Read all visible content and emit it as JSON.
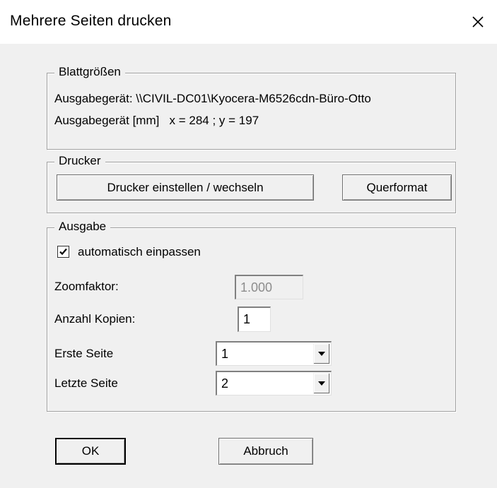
{
  "window": {
    "title": "Mehrere Seiten drucken",
    "close_icon": "close-icon"
  },
  "blattgroessen": {
    "legend": "Blattgrößen",
    "device_line": "Ausgabegerät: \\\\CIVIL-DC01\\Kyocera-M6526cdn-Büro-Otto",
    "size_line": "Ausgabegerät [mm]   x = 284 ; y = 197"
  },
  "drucker": {
    "legend": "Drucker",
    "setup_button": "Drucker einstellen / wechseln",
    "format_button": "Querformat"
  },
  "ausgabe": {
    "legend": "Ausgabe",
    "auto_fit": {
      "label": "automatisch einpassen",
      "checked": true
    },
    "zoom": {
      "label": "Zoomfaktor:",
      "value": "1.000"
    },
    "copies": {
      "label": "Anzahl Kopien:",
      "value": "1"
    },
    "first_page": {
      "label": "Erste Seite",
      "value": "1"
    },
    "last_page": {
      "label": "Letzte Seite",
      "value": "2"
    }
  },
  "buttons": {
    "ok": "OK",
    "cancel": "Abbruch"
  }
}
